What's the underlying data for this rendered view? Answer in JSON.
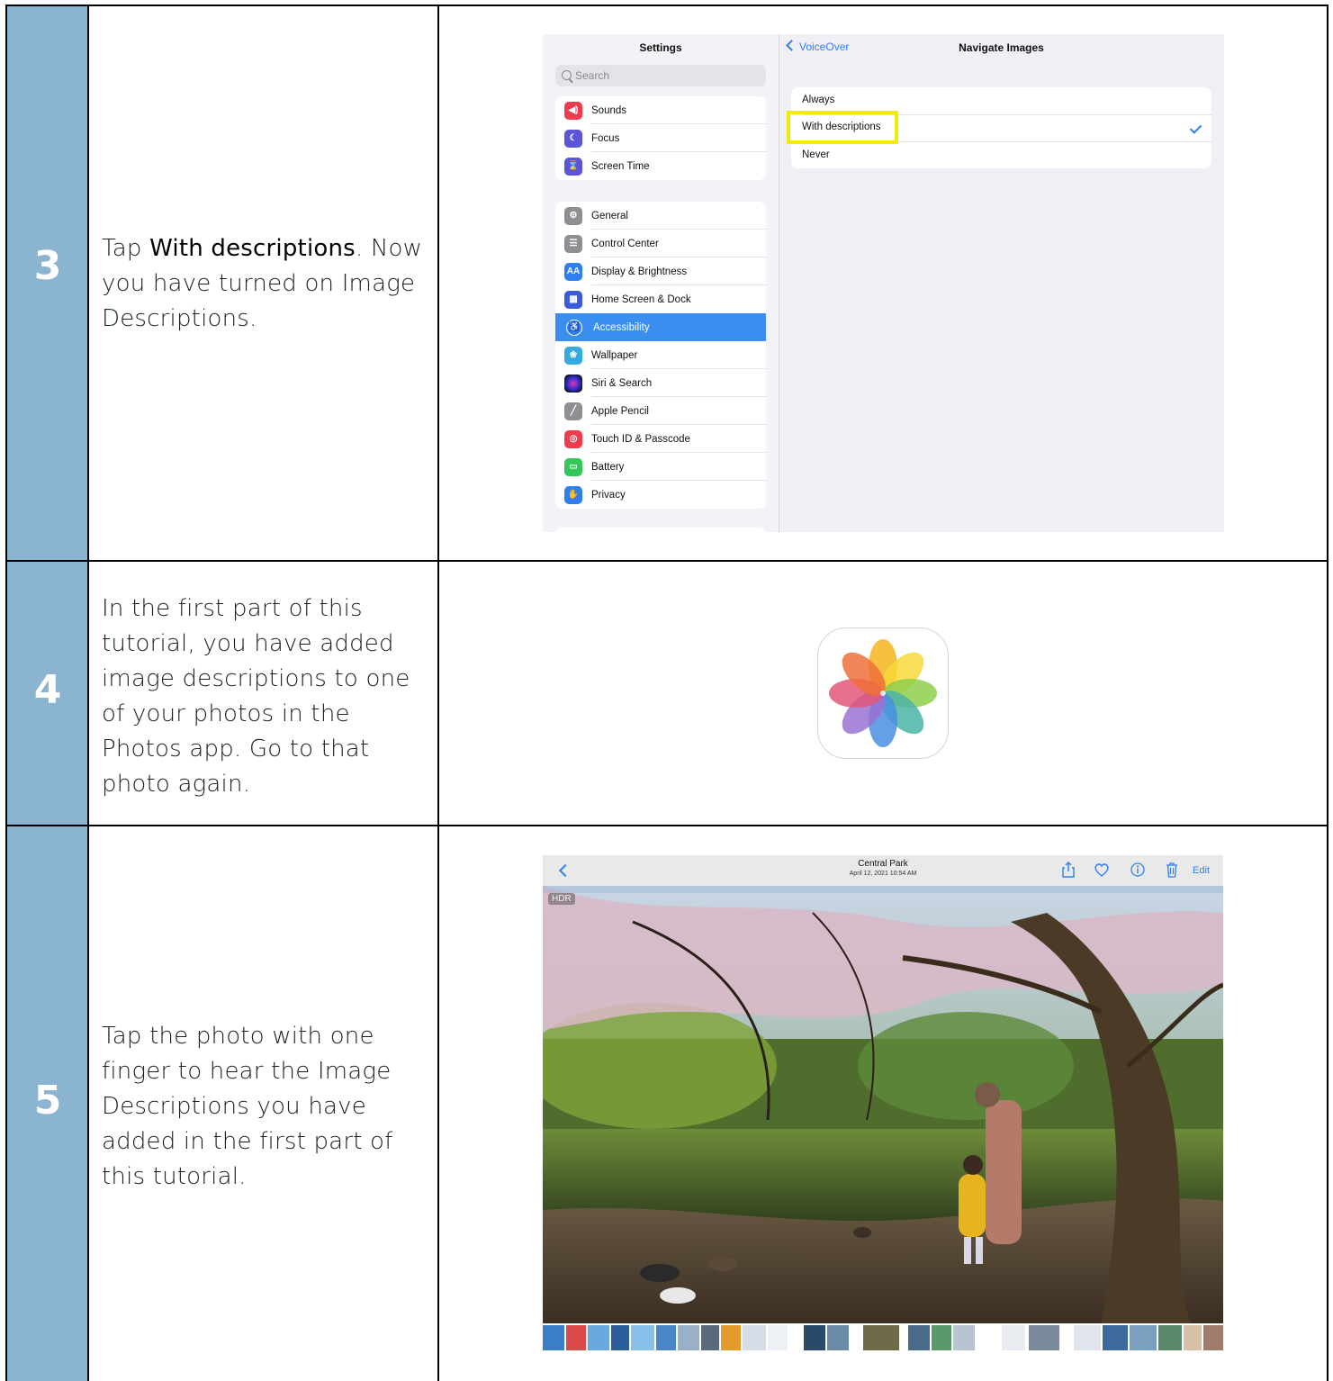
{
  "steps": [
    {
      "number": "3",
      "text_pre": "Tap ",
      "text_bold": "With descriptions",
      "text_post": ". Now you have turned on Image Descriptions."
    },
    {
      "number": "4",
      "text": "In the first part of this tutorial, you have added image descriptions to one of your photos in the Photos app. Go to that photo again."
    },
    {
      "number": "5",
      "text": "Tap the photo with one finger to hear the Image Descriptions you have added in the first part of this tutorial."
    }
  ],
  "settings_screen": {
    "sidebar_title": "Settings",
    "search_placeholder": "Search",
    "group1": [
      {
        "label": "Sounds",
        "icon": "speaker-icon",
        "color": "#ef3b4e"
      },
      {
        "label": "Focus",
        "icon": "moon-icon",
        "color": "#5b56d6"
      },
      {
        "label": "Screen Time",
        "icon": "hourglass-icon",
        "color": "#5b56d6"
      }
    ],
    "group2": [
      {
        "label": "General",
        "icon": "gear-icon",
        "color": "#8e8e93"
      },
      {
        "label": "Control Center",
        "icon": "toggles-icon",
        "color": "#8e8e93"
      },
      {
        "label": "Display & Brightness",
        "icon": "text-size-icon",
        "color": "#2f7ff0"
      },
      {
        "label": "Home Screen & Dock",
        "icon": "grid-icon",
        "color": "#3b5bdb"
      },
      {
        "label": "Accessibility",
        "icon": "accessibility-icon",
        "color": "#2f7ff0",
        "selected": true
      },
      {
        "label": "Wallpaper",
        "icon": "flower-icon",
        "color": "#35aadc"
      },
      {
        "label": "Siri & Search",
        "icon": "siri-icon",
        "color": "#222222"
      },
      {
        "label": "Apple Pencil",
        "icon": "pencil-icon",
        "color": "#8e8e93"
      },
      {
        "label": "Touch ID & Passcode",
        "icon": "fingerprint-icon",
        "color": "#ef3b4e"
      },
      {
        "label": "Battery",
        "icon": "battery-icon",
        "color": "#34c759"
      },
      {
        "label": "Privacy",
        "icon": "hand-icon",
        "color": "#2f7ff0"
      }
    ],
    "back_label": "VoiceOver",
    "detail_title": "Navigate Images",
    "options": [
      "Always",
      "With descriptions",
      "Never"
    ],
    "selected_option": "With descriptions",
    "highlight_color": "#f2ea08",
    "accent_color": "#2f7ff0"
  },
  "photo_viewer": {
    "title": "Central Park",
    "date": "April 12, 2021  10:54 AM",
    "edit_label": "Edit",
    "hdr_badge": "HDR"
  }
}
